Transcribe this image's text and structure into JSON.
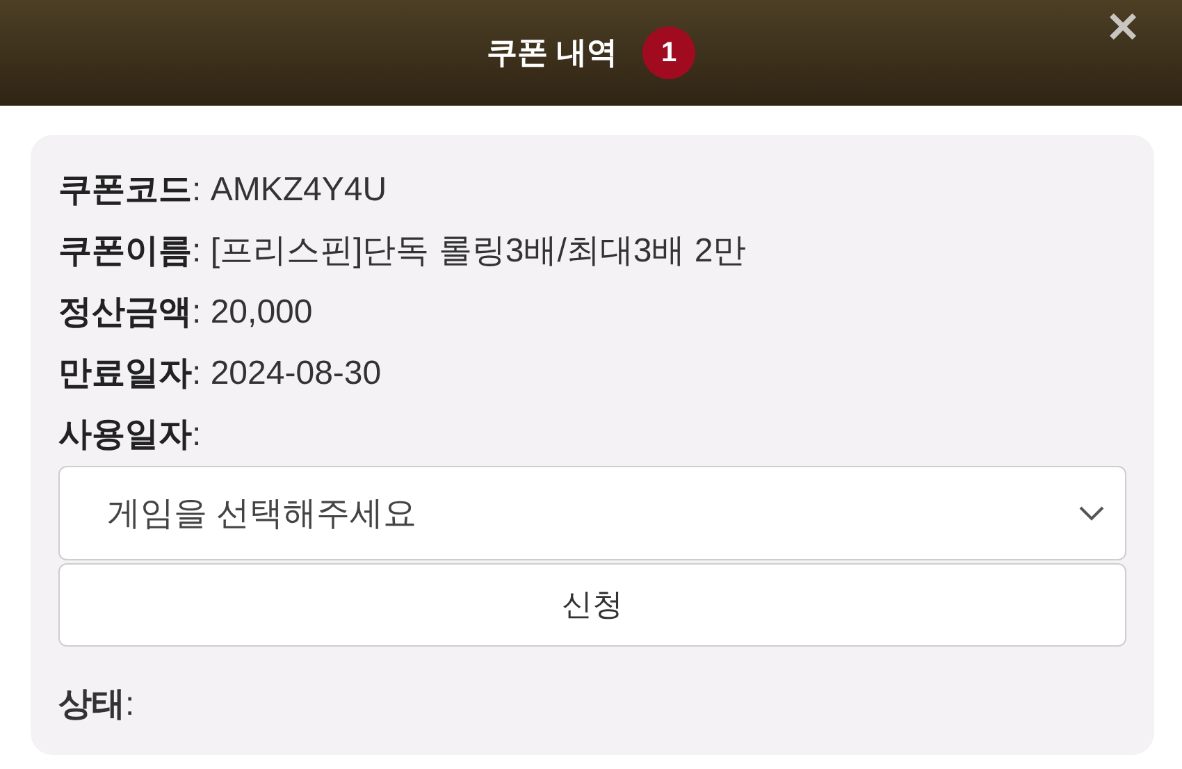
{
  "header": {
    "title": "쿠폰 내역",
    "badge": "1",
    "close": "✕"
  },
  "fields": [
    {
      "text": "**쿠폰코드**: AMKZ4Y4U"
    },
    {
      "text": "**쿠폰이름**: [프리스핀]단독 롤링3배/최대3배 2만"
    },
    {
      "text": "**정산금액**: 20,000"
    },
    {
      "text": "**만료일자**: 2024-08-30"
    },
    {
      "text": "**사용일자**:"
    }
  ],
  "game_select": {
    "placeholder": "게임을 선택해주세요"
  },
  "apply_button": "신청",
  "status": {
    "text": "**상태**:"
  }
}
